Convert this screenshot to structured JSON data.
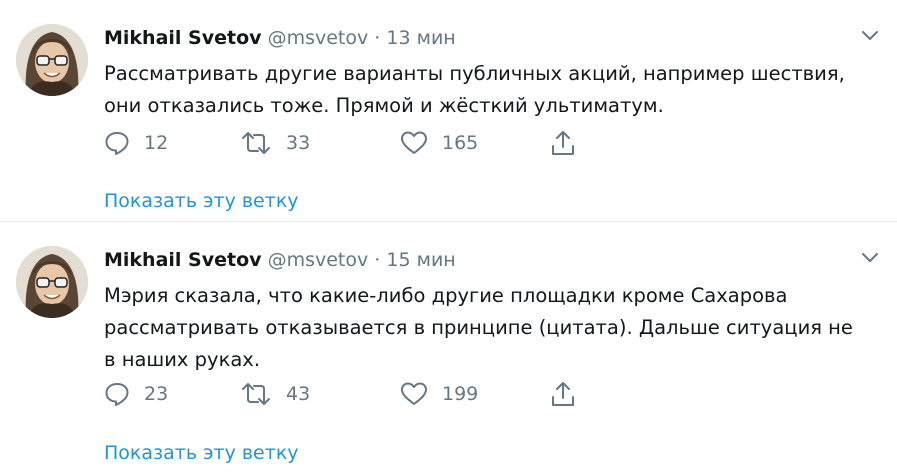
{
  "tweets": [
    {
      "name": "Mikhail Svetov",
      "handle": "@msvetov",
      "separator": "·",
      "time": "13 мин",
      "text": "Рассматривать другие варианты публичных акций, например шествия, они отказались тоже. Прямой и жёсткий ультиматум.",
      "replies": "12",
      "retweets": "33",
      "likes": "165",
      "thread_link": "Показать эту ветку"
    },
    {
      "name": "Mikhail Svetov",
      "handle": "@msvetov",
      "separator": "·",
      "time": "15 мин",
      "text": "Мэрия сказала, что какие-либо другие площадки кроме Сахарова рассматривать отказывается в принципе (цитата). Дальше ситуация не в наших руках.",
      "replies": "23",
      "retweets": "43",
      "likes": "199",
      "thread_link": "Показать эту ветку"
    }
  ],
  "icons": {
    "reply": "reply-icon",
    "retweet": "retweet-icon",
    "like": "heart-icon",
    "share": "share-icon",
    "menu": "chevron-down-icon"
  },
  "colors": {
    "text": "#14171a",
    "secondary": "#657786",
    "link": "#1b95e0",
    "divider": "#e6ecf0"
  }
}
